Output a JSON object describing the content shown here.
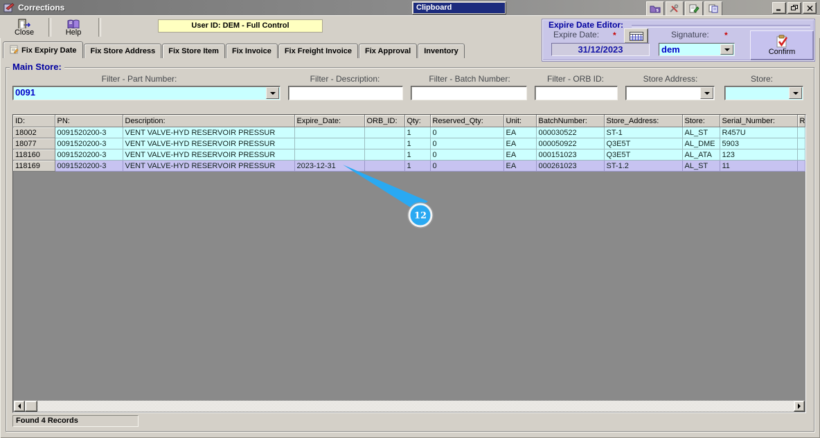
{
  "window": {
    "title": "Corrections",
    "clipboard_toolbar_title": "Clipboard"
  },
  "toolbar": {
    "close": "Close",
    "help": "Help",
    "user_banner": "User ID: DEM - Full Control"
  },
  "expire_editor": {
    "title": "Expire Date Editor:",
    "expire_date_label": "Expire Date:",
    "expire_required": "*",
    "expire_value": "31/12/2023",
    "signature_label": "Signature:",
    "signature_required": "*",
    "signature_value": "dem",
    "confirm": "Confirm"
  },
  "tabs": [
    {
      "label": "Fix Expiry Date",
      "active": true
    },
    {
      "label": "Fix Store Address",
      "active": false
    },
    {
      "label": "Fix Store Item",
      "active": false
    },
    {
      "label": "Fix Invoice",
      "active": false
    },
    {
      "label": "Fix Freight Invoice",
      "active": false
    },
    {
      "label": "Fix Approval",
      "active": false
    },
    {
      "label": "Inventory",
      "active": false
    }
  ],
  "main_store": {
    "title": "Main Store:",
    "filters": [
      {
        "label": "Filter - Part Number:",
        "value": "0091"
      },
      {
        "label": "Filter - Description:",
        "value": ""
      },
      {
        "label": "Filter - Batch Number:",
        "value": ""
      },
      {
        "label": "Filter - ORB ID:",
        "value": ""
      },
      {
        "label": "Store Address:",
        "value": ""
      },
      {
        "label": "Store:",
        "value": ""
      }
    ]
  },
  "grid": {
    "columns": [
      "ID:",
      "PN:",
      "Description:",
      "Expire_Date:",
      "ORB_ID:",
      "Qty:",
      "Reserved_Qty:",
      "Unit:",
      "BatchNumber:",
      "Store_Address:",
      "Store:",
      "Serial_Number:",
      "Re"
    ],
    "rows": [
      [
        "18002",
        "0091520200-3",
        "VENT VALVE-HYD RESERVOIR PRESSUR",
        "",
        "",
        "1",
        "0",
        "EA",
        "000030522",
        "ST-1",
        "AL_ST",
        "R457U",
        ""
      ],
      [
        "18077",
        "0091520200-3",
        "VENT VALVE-HYD RESERVOIR PRESSUR",
        "",
        "",
        "1",
        "0",
        "EA",
        "000050922",
        "Q3E5T",
        "AL_DME",
        "5903",
        ""
      ],
      [
        "118160",
        "0091520200-3",
        "VENT VALVE-HYD RESERVOIR PRESSUR",
        "",
        "",
        "1",
        "0",
        "EA",
        "000151023",
        "Q3E5T",
        "AL_ATA",
        "123",
        ""
      ],
      [
        "118169",
        "0091520200-3",
        "VENT VALVE-HYD RESERVOIR PRESSUR",
        "2023-12-31",
        "",
        "1",
        "0",
        "EA",
        "000261023",
        "ST-1.2",
        "AL_ST",
        "11",
        ""
      ]
    ],
    "selected_row": 3
  },
  "annotation": {
    "step_badge": "12"
  },
  "status": {
    "text": "Found 4 Records"
  },
  "colors": {
    "row_cyan": "#ccffff",
    "row_selected": "#c7c3f1",
    "panel_lavender": "#c9c6e8",
    "banner_yellow": "#ffffc0",
    "accent_navy": "#0000a0",
    "value_blue": "#0000c8",
    "badge_blue": "#2aa9f2"
  }
}
